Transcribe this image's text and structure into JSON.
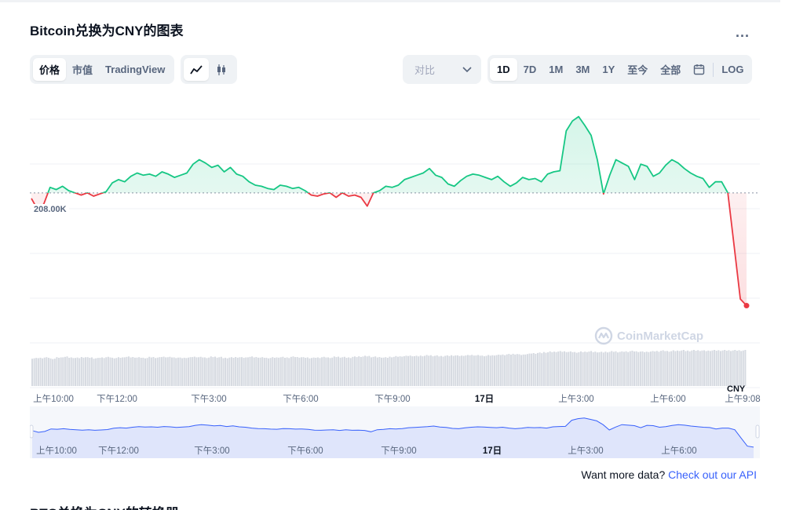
{
  "header": {
    "title": "Bitcoin兑换为CNY的图表",
    "more_label": "..."
  },
  "tabs": [
    {
      "label": "价格",
      "active": true
    },
    {
      "label": "市值",
      "active": false
    },
    {
      "label": "TradingView",
      "active": false
    }
  ],
  "chart_types": [
    {
      "icon": "line-chart-icon",
      "active": true
    },
    {
      "icon": "candlestick-icon",
      "active": false
    }
  ],
  "compare": {
    "label": "对比"
  },
  "ranges": [
    {
      "label": "1D",
      "active": true
    },
    {
      "label": "7D",
      "active": false
    },
    {
      "label": "1M",
      "active": false
    },
    {
      "label": "3M",
      "active": false
    },
    {
      "label": "1Y",
      "active": false
    },
    {
      "label": "至今",
      "active": false
    },
    {
      "label": "全部",
      "active": false
    },
    {
      "icon": "calendar-icon"
    },
    {
      "label": "LOG",
      "active": false
    }
  ],
  "watermark": "CoinMarketCap",
  "currency_label": "CNY",
  "reference_price_label": "208.00K",
  "x_labels": [
    {
      "text": "上午10:00",
      "bold": false
    },
    {
      "text": "下午12:00",
      "bold": false
    },
    {
      "text": "下午3:00",
      "bold": false
    },
    {
      "text": "下午6:00",
      "bold": false
    },
    {
      "text": "下午9:00",
      "bold": false
    },
    {
      "text": "17日",
      "bold": true
    },
    {
      "text": "上午3:00",
      "bold": false
    },
    {
      "text": "上午6:00",
      "bold": false
    },
    {
      "text": "上午9:08",
      "bold": false
    }
  ],
  "nav_labels": [
    {
      "text": "上午10:00",
      "bold": false
    },
    {
      "text": "下午12:00",
      "bold": false
    },
    {
      "text": "下午3:00",
      "bold": false
    },
    {
      "text": "下午6:00",
      "bold": false
    },
    {
      "text": "下午9:00",
      "bold": false
    },
    {
      "text": "17日",
      "bold": true
    },
    {
      "text": "上午3:00",
      "bold": false
    },
    {
      "text": "上午6:00",
      "bold": false
    }
  ],
  "api": {
    "text": "Want more data?",
    "link": "Check out our API"
  },
  "footer": {
    "next_title": "BTC兑换为CNY的转换器"
  },
  "colors": {
    "up": "#16c784",
    "down": "#ea3943",
    "accent": "#3861fb"
  },
  "chart_data": {
    "type": "line",
    "baseline": 208000,
    "ylim": [
      195000,
      217000
    ],
    "values": [
      207500,
      206500,
      207000,
      208500,
      208300,
      208600,
      208200,
      208000,
      207800,
      208000,
      207700,
      207900,
      208100,
      208900,
      209200,
      209000,
      209500,
      209800,
      209600,
      209700,
      209500,
      209900,
      209700,
      209400,
      209600,
      209800,
      210600,
      211000,
      210700,
      210300,
      210500,
      209900,
      210300,
      209700,
      209500,
      209000,
      208700,
      208600,
      208400,
      208300,
      208700,
      208600,
      208400,
      208500,
      208200,
      207800,
      207700,
      207900,
      208000,
      207600,
      208000,
      207700,
      207800,
      207600,
      206800,
      208000,
      208200,
      208600,
      208500,
      208700,
      209200,
      209400,
      209600,
      209800,
      210200,
      209600,
      209400,
      208800,
      208600,
      209100,
      209500,
      209700,
      209600,
      209400,
      209200,
      209500,
      209000,
      208600,
      208900,
      209400,
      209200,
      209300,
      209000,
      209700,
      209900,
      210000,
      213600,
      214500,
      214900,
      214100,
      213200,
      211000,
      207900,
      209600,
      211000,
      210700,
      210400,
      209200,
      210600,
      210400,
      209500,
      209800,
      210500,
      211000,
      210700,
      210200,
      209800,
      209500,
      209300,
      208500,
      209000,
      209000,
      208000,
      203200,
      198400,
      197800
    ],
    "volume_relative": [
      0.78,
      0.79,
      0.8,
      0.77,
      0.8,
      0.82,
      0.8,
      0.79,
      0.81,
      0.8,
      0.78,
      0.8,
      0.81,
      0.79,
      0.8,
      0.82,
      0.81,
      0.8,
      0.79,
      0.81,
      0.8,
      0.82,
      0.81,
      0.8,
      0.79,
      0.8,
      0.82,
      0.81,
      0.8,
      0.82,
      0.81,
      0.79,
      0.8,
      0.81,
      0.8,
      0.82,
      0.81,
      0.8,
      0.79,
      0.8,
      0.81,
      0.8,
      0.82,
      0.81,
      0.8,
      0.79,
      0.8,
      0.81,
      0.8,
      0.82,
      0.81,
      0.8,
      0.82,
      0.83,
      0.84,
      0.82,
      0.81,
      0.8,
      0.82,
      0.83,
      0.84,
      0.85,
      0.84,
      0.85,
      0.86,
      0.85,
      0.84,
      0.85,
      0.86,
      0.85,
      0.86,
      0.87,
      0.86,
      0.85,
      0.86,
      0.87,
      0.88,
      0.89,
      0.9,
      0.88,
      0.9,
      0.92,
      0.93,
      0.95,
      0.96,
      0.97,
      0.97,
      0.96,
      0.95,
      0.96,
      0.97,
      0.96,
      0.95,
      0.96,
      0.97,
      0.96,
      0.97,
      0.98,
      0.97,
      0.96,
      0.97,
      0.98,
      0.99,
      0.98,
      0.99,
      1.0,
      0.99,
      1.0,
      1.0,
      0.99,
      1.0,
      1.0,
      1.0,
      1.0,
      1.0,
      1.0
    ],
    "xlabel": "",
    "ylabel": ""
  }
}
